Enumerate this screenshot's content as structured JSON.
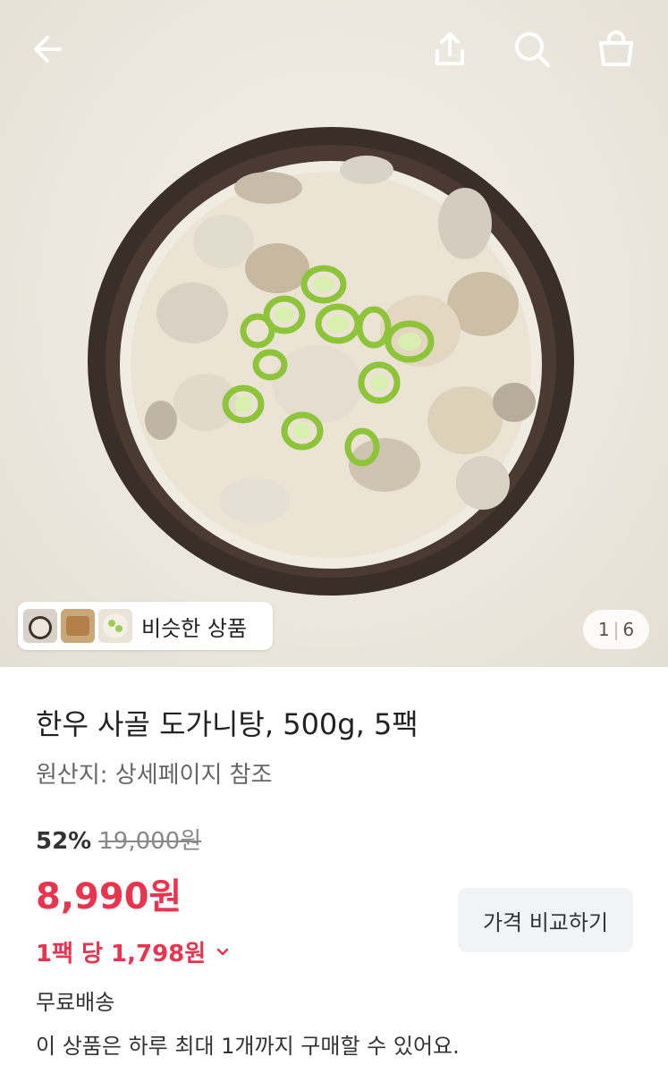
{
  "hero": {
    "similar_label": "비슷한 상품",
    "pager": {
      "current": "1",
      "total": "6"
    }
  },
  "topbar": {
    "icons": [
      "back-arrow-icon",
      "share-icon",
      "search-icon",
      "cart-icon"
    ]
  },
  "product": {
    "title": "한우 사골 도가니탕, 500g, 5팩",
    "origin": "원산지: 상세페이지 참조",
    "discount": "52%",
    "original_price": "19,000원",
    "price": "8,990원",
    "unit_price": "1팩 당 1,798원",
    "compare_button": "가격 비교하기",
    "shipping": "무료배송",
    "purchase_limit": "이 상품은 하루 최대 1개까지 구매할 수 있어요."
  },
  "colors": {
    "price_red": "#e8344e",
    "button_bg": "#f2f3f5"
  }
}
